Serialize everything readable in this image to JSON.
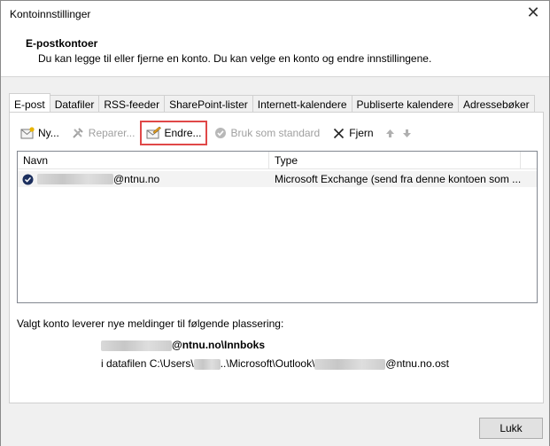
{
  "window": {
    "title": "Kontoinnstillinger"
  },
  "header": {
    "title": "E-postkontoer",
    "subtitle": "Du kan legge til eller fjerne en konto. Du kan velge en konto og endre innstillingene."
  },
  "tabs": [
    {
      "label": "E-post"
    },
    {
      "label": "Datafiler"
    },
    {
      "label": "RSS-feeder"
    },
    {
      "label": "SharePoint-lister"
    },
    {
      "label": "Internett-kalendere"
    },
    {
      "label": "Publiserte kalendere"
    },
    {
      "label": "Adressebøker"
    }
  ],
  "toolbar": {
    "new_label": "Ny...",
    "repair_label": "Reparer...",
    "change_label": "Endre...",
    "default_label": "Bruk som standard",
    "remove_label": "Fjern"
  },
  "list": {
    "col_name": "Navn",
    "col_type": "Type",
    "rows": [
      {
        "name_suffix": "@ntnu.no",
        "type": "Microsoft Exchange (send fra denne kontoen som ..."
      }
    ]
  },
  "delivery": {
    "label": "Valgt konto leverer nye meldinger til følgende plassering:",
    "folder_suffix": "@ntnu.no\\Innboks",
    "file_prefix": "i datafilen C:\\Users\\",
    "file_middle": "..\\Microsoft\\Outlook\\",
    "file_suffix": "@ntnu.no.ost"
  },
  "buttons": {
    "close_label": "Lukk"
  },
  "colors": {
    "highlight": "#e04848"
  }
}
